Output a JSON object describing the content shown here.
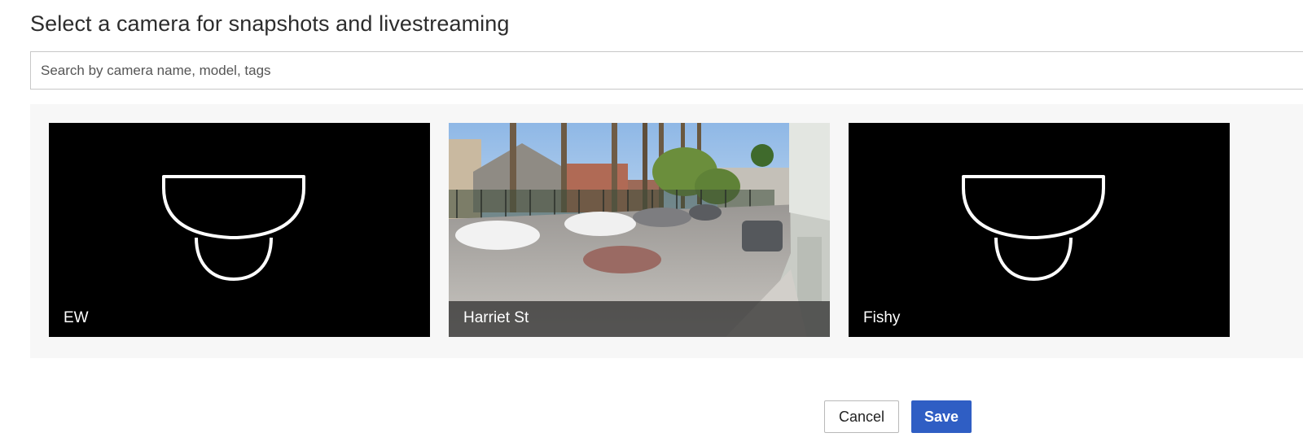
{
  "dialog": {
    "title": "Select a camera for snapshots and livestreaming"
  },
  "search": {
    "placeholder": "Search by camera name, model, tags",
    "value": ""
  },
  "cameras": [
    {
      "name": "EW",
      "thumbnail": "dome-camera-icon"
    },
    {
      "name": "Harriet St",
      "thumbnail": "street-view-snapshot"
    },
    {
      "name": "Fishy",
      "thumbnail": "dome-camera-icon"
    }
  ],
  "actions": {
    "cancel_label": "Cancel",
    "save_label": "Save"
  },
  "colors": {
    "save_button": "#2f5ec4",
    "panel_background": "#f7f7f7",
    "card_background": "#000000"
  }
}
